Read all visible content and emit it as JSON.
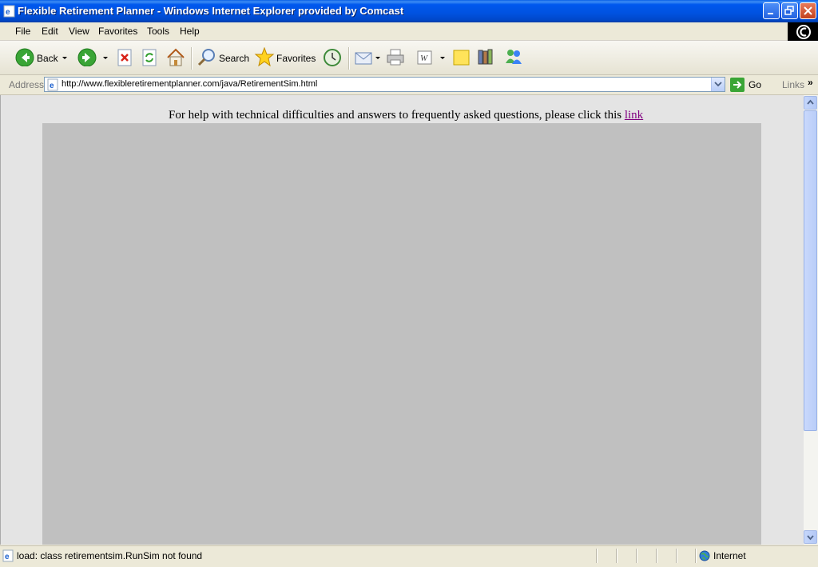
{
  "window": {
    "title": "Flexible Retirement Planner - Windows Internet Explorer provided by Comcast"
  },
  "menu": {
    "items": [
      "File",
      "Edit",
      "View",
      "Favorites",
      "Tools",
      "Help"
    ]
  },
  "toolbar": {
    "back_label": "Back",
    "search_label": "Search",
    "favorites_label": "Favorites"
  },
  "address": {
    "label": "Address",
    "url": "http://www.flexibleretirementplanner.com/java/RetirementSim.html",
    "go_label": "Go",
    "links_label": "Links",
    "links_chevron": "»"
  },
  "page": {
    "help_text": "For help with technical difficulties and answers to frequently asked questions, please click this",
    "help_link": "link"
  },
  "status": {
    "message": "load: class retirementsim.RunSim not found",
    "zone": "Internet"
  },
  "colors": {
    "title_bar": "#0054e3",
    "applet_bg": "#c0c0c0",
    "page_bg": "#e4e4e4",
    "visited_link": "#800080"
  }
}
